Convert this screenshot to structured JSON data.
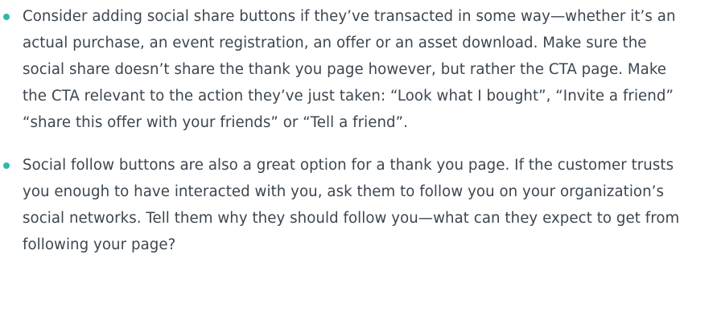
{
  "colors": {
    "bullet": "#2fb8ac",
    "text": "#3c4650"
  },
  "list": {
    "items": [
      {
        "text": "Consider adding social share buttons if they’ve transacted in some way—whether it’s an actual purchase, an event registration, an offer or an asset download. Make sure the social share doesn’t share the thank you page however, but rather the CTA page. Make the CTA relevant to the action they’ve just taken: “Look what I bought”, “Invite a friend” “share this offer with your friends” or “Tell a friend”."
      },
      {
        "text": "Social follow buttons are also a great option for a thank you page. If the customer trusts you enough to have interacted with you, ask them to follow you on your organization’s social networks. Tell them why they should follow you—what can they expect to get from following your page?"
      }
    ]
  }
}
